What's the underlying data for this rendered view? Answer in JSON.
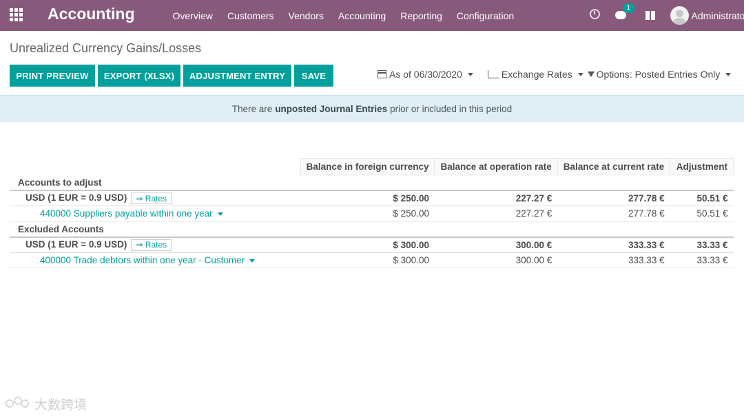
{
  "navbar": {
    "app_title": "Accounting",
    "menu": [
      "Overview",
      "Customers",
      "Vendors",
      "Accounting",
      "Reporting",
      "Configuration"
    ],
    "chat_badge": "1",
    "username": "Administrator",
    "color": "#875a7b"
  },
  "page": {
    "title": "Unrealized Currency Gains/Losses",
    "buttons": {
      "print_preview": "PRINT PREVIEW",
      "export": "EXPORT (XLSX)",
      "adjustment_entry": "ADJUSTMENT ENTRY",
      "save": "SAVE"
    },
    "filters": {
      "date": "As of 06/30/2020",
      "rates": "Exchange Rates",
      "options": "Options: Posted Entries Only"
    },
    "accent": "#00a09d"
  },
  "alert": {
    "prefix": "There are",
    "bold": "unposted Journal Entries",
    "suffix": "prior or included in this period"
  },
  "table": {
    "headers": [
      "Balance in foreign currency",
      "Balance at operation rate",
      "Balance at current rate",
      "Adjustment"
    ],
    "rates_label": "⇒ Rates",
    "sections": [
      {
        "title": "Accounts to adjust",
        "group": {
          "label": "USD (1 EUR = 0.9 USD)",
          "values": [
            "$ 250.00",
            "227.27 €",
            "277.78 €",
            "50.51 €"
          ]
        },
        "detail": {
          "label": "440000 Suppliers payable within one year",
          "values": [
            "$ 250.00",
            "227.27 €",
            "277.78 €",
            "50.51 €"
          ]
        }
      },
      {
        "title": "Excluded Accounts",
        "group": {
          "label": "USD (1 EUR = 0.9 USD)",
          "values": [
            "$ 300.00",
            "300.00 €",
            "333.33 €",
            "33.33 €"
          ]
        },
        "detail": {
          "label": "400000 Trade debtors within one year - Customer",
          "values": [
            "$ 300.00",
            "300.00 €",
            "333.33 €",
            "33.33 €"
          ]
        }
      }
    ]
  },
  "watermark": {
    "text": "大数跨境"
  }
}
